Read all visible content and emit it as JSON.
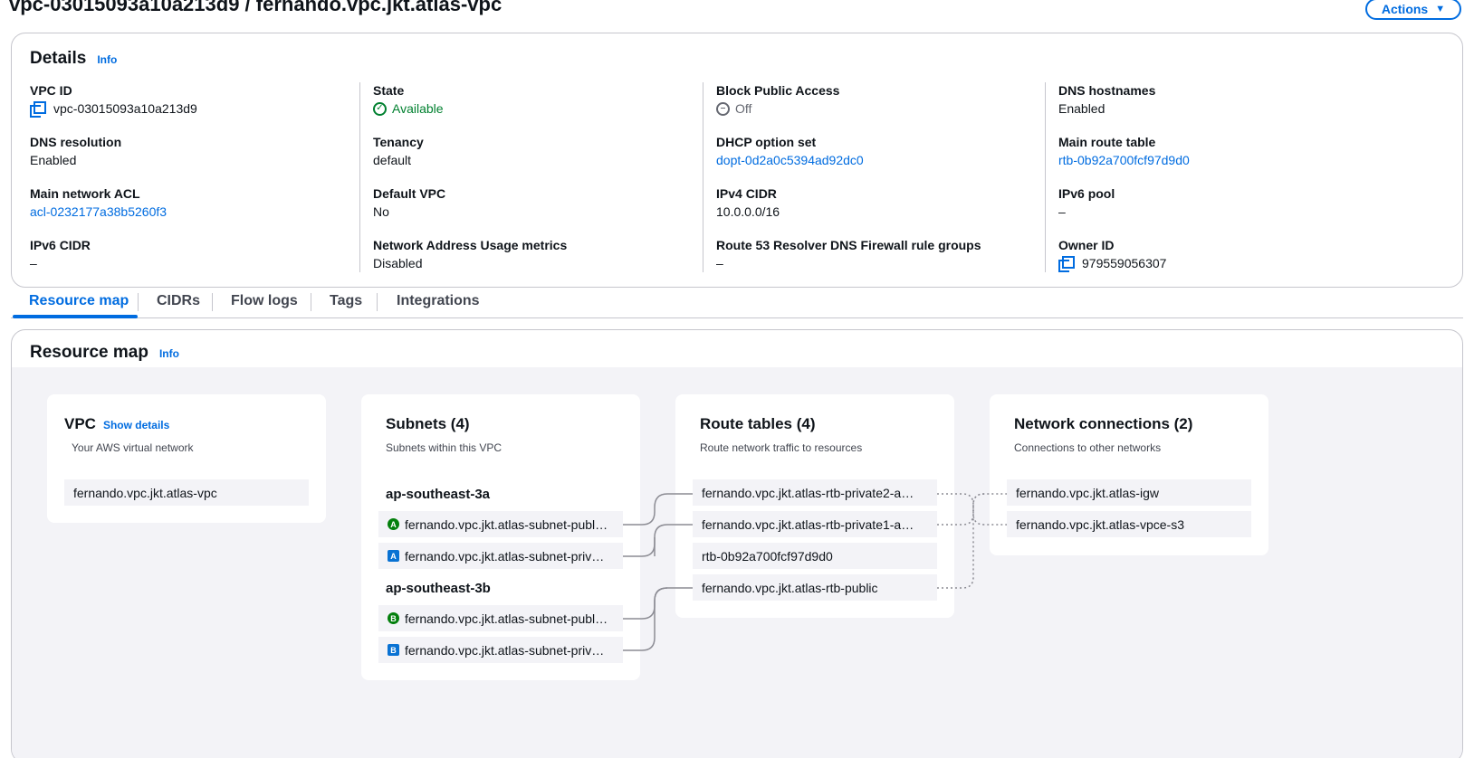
{
  "header": {
    "title": "vpc-03015093a10a213d9 / fernando.vpc.jkt.atlas-vpc",
    "actions_label": "Actions"
  },
  "details": {
    "heading": "Details",
    "info": "Info",
    "fields": [
      {
        "label": "VPC ID",
        "value": "vpc-03015093a10a213d9"
      },
      {
        "label": "State",
        "value": "Available"
      },
      {
        "label": "Block Public Access",
        "value": "Off"
      },
      {
        "label": "DNS hostnames",
        "value": "Enabled"
      },
      {
        "label": "DNS resolution",
        "value": "Enabled"
      },
      {
        "label": "Tenancy",
        "value": "default"
      },
      {
        "label": "DHCP option set",
        "value": "dopt-0d2a0c5394ad92dc0"
      },
      {
        "label": "Main route table",
        "value": "rtb-0b92a700fcf97d9d0"
      },
      {
        "label": "Main network ACL",
        "value": "acl-0232177a38b5260f3"
      },
      {
        "label": "Default VPC",
        "value": "No"
      },
      {
        "label": "IPv4 CIDR",
        "value": "10.0.0.0/16"
      },
      {
        "label": "IPv6 pool",
        "value": "–"
      },
      {
        "label": "IPv6 CIDR",
        "value": "–"
      },
      {
        "label": "Network Address Usage metrics",
        "value": "Disabled"
      },
      {
        "label": "Route 53 Resolver DNS Firewall rule groups",
        "value": "–"
      },
      {
        "label": "Owner ID",
        "value": "979559056307"
      }
    ]
  },
  "tabs": [
    "Resource map",
    "CIDRs",
    "Flow logs",
    "Tags",
    "Integrations"
  ],
  "resource_map": {
    "heading": "Resource map",
    "info": "Info",
    "vpc": {
      "title": "VPC",
      "show_details": "Show details",
      "subtitle": "Your AWS virtual network",
      "node": "fernando.vpc.jkt.atlas-vpc"
    },
    "subnets": {
      "title": "Subnets (4)",
      "subtitle": "Subnets within this VPC",
      "zones": [
        {
          "name": "ap-southeast-3a",
          "items": [
            {
              "badge": "A",
              "kind": "public",
              "label": "fernando.vpc.jkt.atlas-subnet-publ…"
            },
            {
              "badge": "A",
              "kind": "private",
              "label": "fernando.vpc.jkt.atlas-subnet-priv…"
            }
          ]
        },
        {
          "name": "ap-southeast-3b",
          "items": [
            {
              "badge": "B",
              "kind": "public",
              "label": "fernando.vpc.jkt.atlas-subnet-publ…"
            },
            {
              "badge": "B",
              "kind": "private",
              "label": "fernando.vpc.jkt.atlas-subnet-priv…"
            }
          ]
        }
      ]
    },
    "route_tables": {
      "title": "Route tables (4)",
      "subtitle": "Route network traffic to resources",
      "items": [
        "fernando.vpc.jkt.atlas-rtb-private2-a…",
        "fernando.vpc.jkt.atlas-rtb-private1-a…",
        "rtb-0b92a700fcf97d9d0",
        "fernando.vpc.jkt.atlas-rtb-public"
      ]
    },
    "network_connections": {
      "title": "Network connections (2)",
      "subtitle": "Connections to other networks",
      "items": [
        "fernando.vpc.jkt.atlas-igw",
        "fernando.vpc.jkt.atlas-vpce-s3"
      ]
    }
  },
  "colors": {
    "accent": "#006ce0",
    "available_green": "#00802f",
    "public_subnet_badge": "#037f0c",
    "private_subnet_badge": "#0972d3",
    "map_background": "#f3f3f7"
  }
}
